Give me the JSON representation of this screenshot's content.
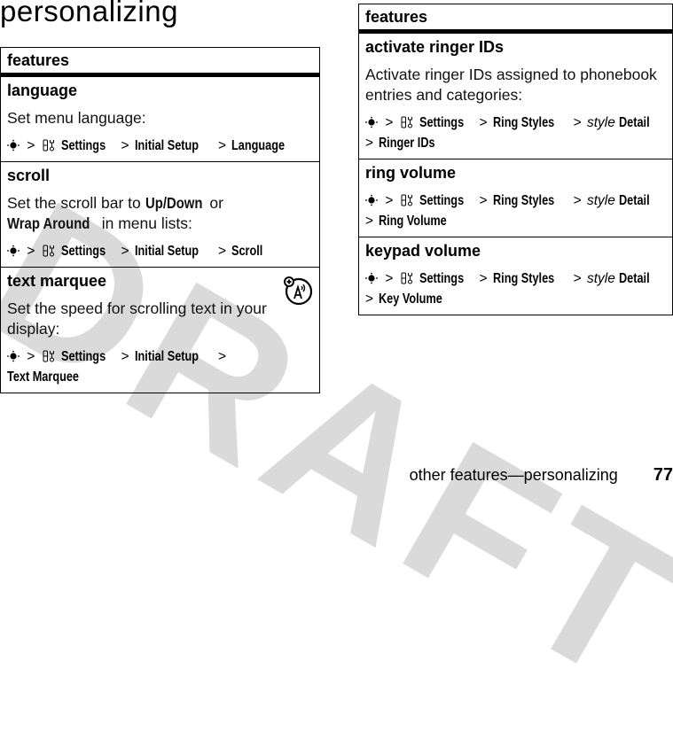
{
  "watermark": "DRAFT",
  "page_title": "personalizing",
  "left_table": {
    "header": "features",
    "rows": [
      {
        "title": "language",
        "description": "Set menu language:",
        "path": [
          "Settings",
          "Initial Setup",
          "Language"
        ]
      },
      {
        "title": "scroll",
        "description_parts": [
          "Set the scroll bar to ",
          "Up/Down",
          " or ",
          "Wrap Around",
          " in menu lists:"
        ],
        "path": [
          "Settings",
          "Initial Setup",
          "Scroll"
        ]
      },
      {
        "title": "text marquee",
        "description": "Set the speed for scrolling text in your display:",
        "path": [
          "Settings",
          "Initial Setup",
          "Text Marquee"
        ],
        "icon": "network-feature-icon"
      }
    ]
  },
  "right_table": {
    "header": "features",
    "rows": [
      {
        "title": "activate ringer IDs",
        "description": "Activate ringer IDs assigned to phonebook entries and categories:",
        "path": [
          "Settings",
          "Ring Styles",
          "style",
          "Detail",
          "Ringer IDs"
        ]
      },
      {
        "title": "ring volume",
        "path": [
          "Settings",
          "Ring Styles",
          "style",
          "Detail",
          "Ring Volume"
        ]
      },
      {
        "title": "keypad volume",
        "path": [
          "Settings",
          "Ring Styles",
          "style",
          "Detail",
          "Key Volume"
        ]
      }
    ]
  },
  "separator": ">",
  "icons": {
    "nav": "nav-key-icon",
    "settings": "settings-icon"
  },
  "footer": {
    "section": "other features—personalizing",
    "page_number": "77"
  }
}
